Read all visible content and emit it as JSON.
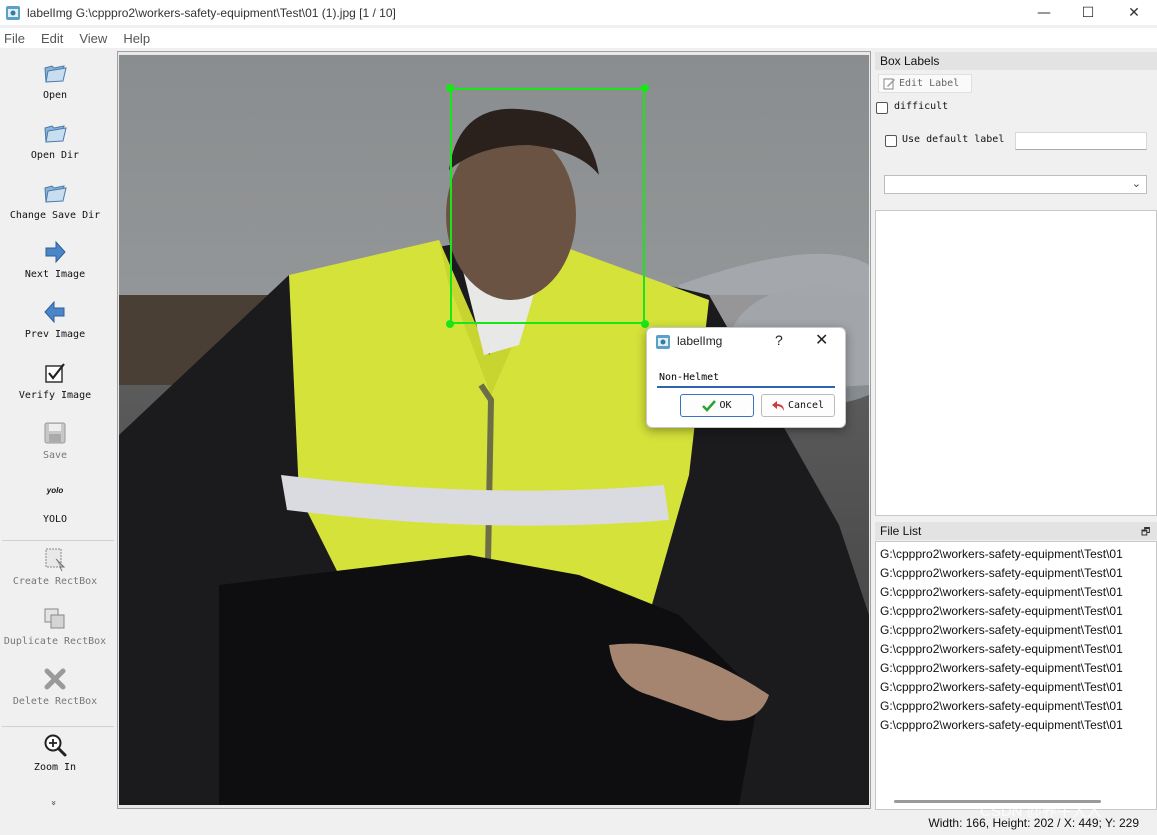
{
  "window": {
    "title": "labelImg G:\\cpppro2\\workers-safety-equipment\\Test\\01 (1).jpg [1 / 10]",
    "minimize": "—",
    "maximize": "☐",
    "close": "✕"
  },
  "menu": [
    "File",
    "Edit",
    "View",
    "Help"
  ],
  "toolbar": {
    "open": "Open",
    "open_dir": "Open Dir",
    "change_save_dir": "Change Save Dir",
    "next_image": "Next Image",
    "prev_image": "Prev Image",
    "verify_image": "Verify Image",
    "save": "Save",
    "format_icon_text": "yolo",
    "format": "YOLO",
    "create_rectbox": "Create RectBox",
    "duplicate_rectbox": "Duplicate RectBox",
    "delete_rectbox": "Delete RectBox",
    "zoom_in": "Zoom In",
    "more": "»"
  },
  "dialog": {
    "title": "labelImg",
    "help": "?",
    "close": "✕",
    "input_value": "Non-Helmet",
    "ok": "OK",
    "cancel": "Cancel"
  },
  "box_labels": {
    "title": "Box Labels",
    "edit_label": "Edit Label",
    "difficult": "difficult",
    "use_default_label": "Use default label",
    "default_label_value": ""
  },
  "file_list": {
    "title": "File List",
    "items": [
      "G:\\cpppro2\\workers-safety-equipment\\Test\\01",
      "G:\\cpppro2\\workers-safety-equipment\\Test\\01",
      "G:\\cpppro2\\workers-safety-equipment\\Test\\01",
      "G:\\cpppro2\\workers-safety-equipment\\Test\\01",
      "G:\\cpppro2\\workers-safety-equipment\\Test\\01",
      "G:\\cpppro2\\workers-safety-equipment\\Test\\01",
      "G:\\cpppro2\\workers-safety-equipment\\Test\\01",
      "G:\\cpppro2\\workers-safety-equipment\\Test\\01",
      "G:\\cpppro2\\workers-safety-equipment\\Test\\01",
      "G:\\cpppro2\\workers-safety-equipment\\Test\\01"
    ]
  },
  "status": "Width: 166, Height: 202 / X: 449; Y: 229",
  "watermark": "CSDN @养牛大人",
  "colors": {
    "bbox": "#19e619",
    "vest": "#d4e23a",
    "accent": "#2f65b0"
  }
}
